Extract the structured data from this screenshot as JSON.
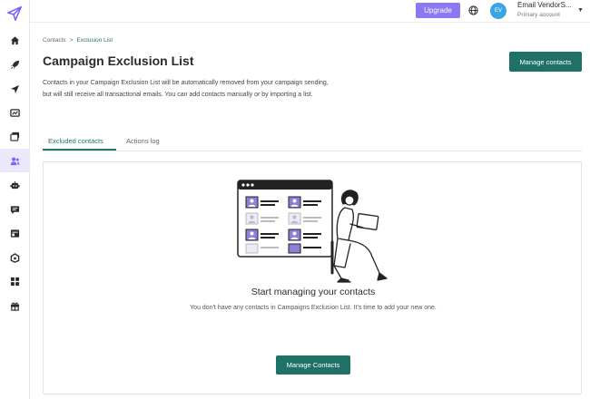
{
  "topbar": {
    "upgrade_label": "Upgrade",
    "avatar_initials": "EV",
    "account_name": "Email VendorS...",
    "account_sub": "Primary account"
  },
  "sidebar": {
    "items": [
      {
        "icon": "home-icon"
      },
      {
        "icon": "rocket-icon"
      },
      {
        "icon": "send-icon"
      },
      {
        "icon": "analytics-icon"
      },
      {
        "icon": "templates-icon"
      },
      {
        "icon": "contacts-icon",
        "active": true
      },
      {
        "icon": "bot-icon"
      },
      {
        "icon": "chat-icon"
      },
      {
        "icon": "landing-page-icon"
      },
      {
        "icon": "integrations-icon"
      },
      {
        "icon": "apps-icon"
      },
      {
        "icon": "gift-icon"
      }
    ]
  },
  "breadcrumb": {
    "root": "Contacts",
    "separator": ">",
    "current": "Exclusion List"
  },
  "page": {
    "title": "Campaign Exclusion List",
    "manage_button": "Manage contacts",
    "description": "Contacts in your Campaign Exclusion List will be automatically removed from your campaign sending, but will still receive all transactional emails. You can add contacts manually or by importing a list."
  },
  "tabs": {
    "excluded": "Excluded contacts",
    "log": "Actions log"
  },
  "empty_state": {
    "title": "Start managing your contacts",
    "description": "You don't have any contacts in Campaigns Exclusion List. It's time to add your new one.",
    "button": "Manage Contacts"
  },
  "colors": {
    "brand_green": "#1f7067",
    "upgrade_purple": "#8d77f2",
    "avatar_blue": "#39a6e3",
    "sidebar_active": "#ece8fb"
  }
}
